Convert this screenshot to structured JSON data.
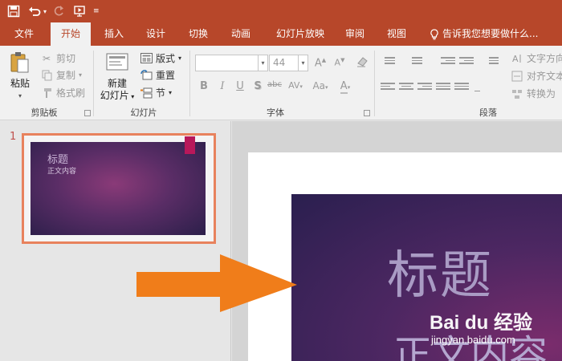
{
  "qat": {
    "save_icon": "save-icon",
    "undo_icon": "undo-icon",
    "redo_icon": "redo-icon",
    "present_icon": "start-from-beginning-icon",
    "customize_icon": "customize-qat-icon"
  },
  "tabs": {
    "file": "文件",
    "home": "开始",
    "insert": "插入",
    "design": "设计",
    "transitions": "切换",
    "animations": "动画",
    "slideshow": "幻灯片放映",
    "review": "审阅",
    "view": "视图",
    "tell_me": "告诉我您想要做什么..."
  },
  "ribbon": {
    "clipboard": {
      "paste": "粘贴",
      "cut": "剪切",
      "copy": "复制",
      "format_painter": "格式刷",
      "label": "剪贴板"
    },
    "slides": {
      "new_slide_line1": "新建",
      "new_slide_line2": "幻灯片",
      "layout": "版式",
      "reset": "重置",
      "section": "节",
      "label": "幻灯片"
    },
    "font": {
      "font_name": "",
      "font_size": "44",
      "grow": "A",
      "shrink": "A",
      "clear": "清除",
      "bold": "B",
      "italic": "I",
      "underline": "U",
      "shadow": "S",
      "strike": "abc",
      "spacing": "AV",
      "case": "Aa",
      "color": "A",
      "label": "字体"
    },
    "paragraph": {
      "text_direction": "文字方向",
      "align_text": "对齐文本",
      "convert_smartart": "转换为",
      "label": "段落"
    }
  },
  "thumbnails": [
    {
      "number": "1",
      "title": "标题",
      "body": "正文内容"
    }
  ],
  "slide": {
    "title": "标题",
    "body": "正文内容"
  },
  "watermark": {
    "logo": "Bai du 经验",
    "url": "jingyan.baidu.com"
  },
  "colors": {
    "accent": "#b7472a",
    "arrow": "#f07d1a",
    "thumb_border": "#e8825d"
  }
}
